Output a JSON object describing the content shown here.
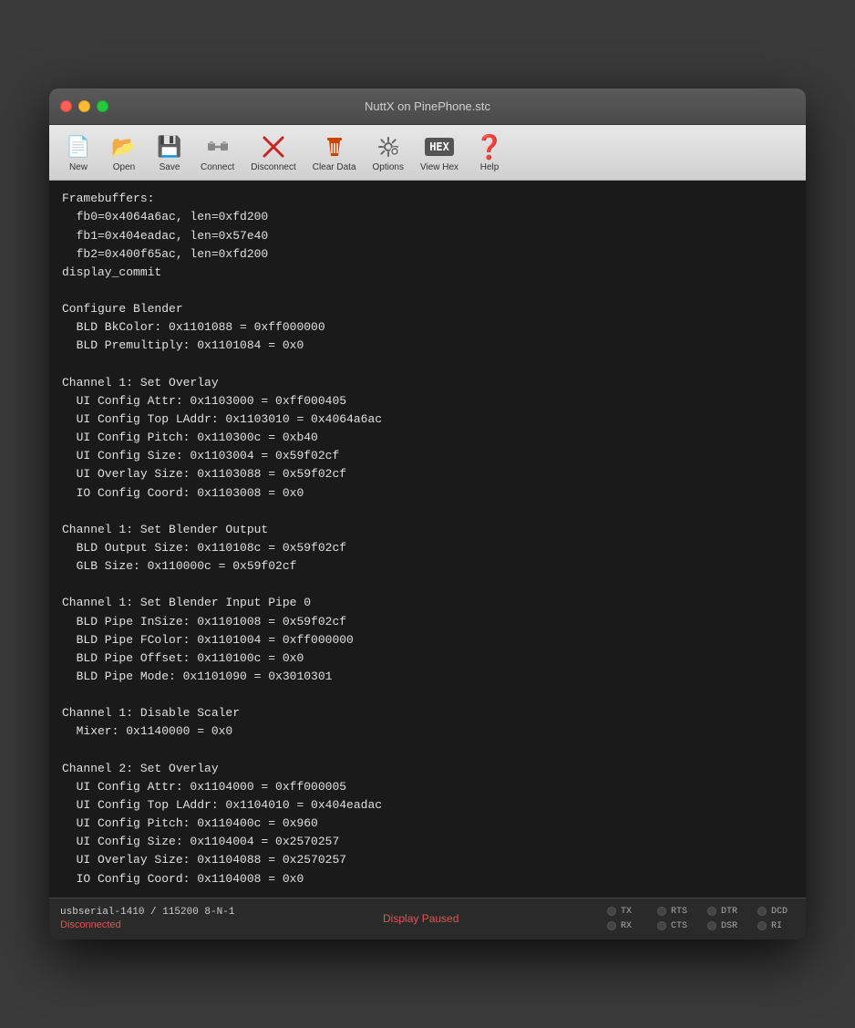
{
  "window": {
    "title": "NuttX on PinePhone.stc"
  },
  "toolbar": {
    "buttons": [
      {
        "id": "new",
        "label": "New",
        "icon": "📄"
      },
      {
        "id": "open",
        "label": "Open",
        "icon": "📂"
      },
      {
        "id": "save",
        "label": "Save",
        "icon": "💾"
      },
      {
        "id": "connect",
        "label": "Connect",
        "icon": "connect"
      },
      {
        "id": "disconnect",
        "label": "Disconnect",
        "icon": "disconnect"
      },
      {
        "id": "cleardata",
        "label": "Clear Data",
        "icon": "cleardata"
      },
      {
        "id": "options",
        "label": "Options",
        "icon": "options"
      },
      {
        "id": "viewhex",
        "label": "View Hex",
        "icon": "hex"
      },
      {
        "id": "help",
        "label": "Help",
        "icon": "help"
      }
    ]
  },
  "terminal": {
    "lines": [
      "Framebuffers:",
      "  fb0=0x4064a6ac, len=0xfd200",
      "  fb1=0x404eadac, len=0x57e40",
      "  fb2=0x400f65ac, len=0xfd200",
      "display_commit",
      "",
      "Configure Blender",
      "  BLD BkColor: 0x1101088 = 0xff000000",
      "  BLD Premultiply: 0x1101084 = 0x0",
      "",
      "Channel 1: Set Overlay",
      "  UI Config Attr: 0x1103000 = 0xff000405",
      "  UI Config Top LAddr: 0x1103010 = 0x4064a6ac",
      "  UI Config Pitch: 0x110300c = 0xb40",
      "  UI Config Size: 0x1103004 = 0x59f02cf",
      "  UI Overlay Size: 0x1103088 = 0x59f02cf",
      "  IO Config Coord: 0x1103008 = 0x0",
      "",
      "Channel 1: Set Blender Output",
      "  BLD Output Size: 0x110108c = 0x59f02cf",
      "  GLB Size: 0x110000c = 0x59f02cf",
      "",
      "Channel 1: Set Blender Input Pipe 0",
      "  BLD Pipe InSize: 0x1101008 = 0x59f02cf",
      "  BLD Pipe FColor: 0x1101004 = 0xff000000",
      "  BLD Pipe Offset: 0x110100c = 0x0",
      "  BLD Pipe Mode: 0x1101090 = 0x3010301",
      "",
      "Channel 1: Disable Scaler",
      "  Mixer: 0x1140000 = 0x0",
      "",
      "Channel 2: Set Overlay",
      "  UI Config Attr: 0x1104000 = 0xff000005",
      "  UI Config Top LAddr: 0x1104010 = 0x404eadac",
      "  UI Config Pitch: 0x110400c = 0x960",
      "  UI Config Size: 0x1104004 = 0x2570257",
      "  UI Overlay Size: 0x1104088 = 0x2570257",
      "  IO Config Coord: 0x1104008 = 0x0"
    ]
  },
  "statusbar": {
    "port_info": "usbserial-1410 / 115200 8-N-1",
    "connection_status": "Disconnected",
    "display_paused": "Display Paused",
    "indicators": [
      {
        "label": "TX",
        "active": false
      },
      {
        "label": "RX",
        "active": false
      },
      {
        "label": "RTS",
        "active": false
      },
      {
        "label": "CTS",
        "active": false
      },
      {
        "label": "DTR",
        "active": false
      },
      {
        "label": "DSR",
        "active": false
      },
      {
        "label": "DCD",
        "active": false
      },
      {
        "label": "RI",
        "active": false
      }
    ]
  }
}
